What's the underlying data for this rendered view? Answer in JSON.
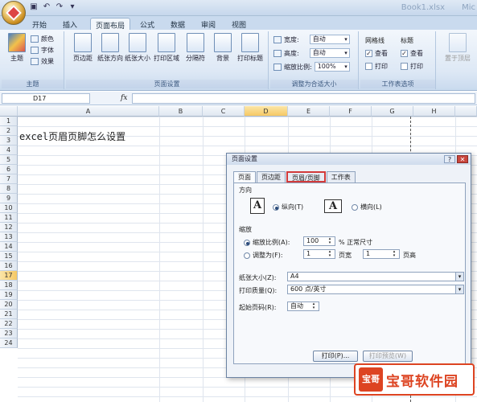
{
  "titlebar": {
    "app_title": "Book1.xlsx",
    "app_title_suffix": "Mic"
  },
  "tabs": [
    "开始",
    "插入",
    "页面布局",
    "公式",
    "数据",
    "审阅",
    "视图"
  ],
  "ribbon": {
    "themes": {
      "big": "主题",
      "colors": "颜色",
      "fonts": "字体",
      "effects": "效果",
      "group": "主题"
    },
    "page_setup": {
      "buttons": [
        "页边距",
        "纸张方向",
        "纸张大小",
        "打印区域",
        "分隔符",
        "背景",
        "打印标题"
      ],
      "group": "页面设置"
    },
    "scale_to_fit": {
      "width_label": "宽度:",
      "width_value": "自动",
      "height_label": "高度:",
      "height_value": "自动",
      "scale_label": "缩放比例:",
      "scale_value": "100%",
      "group": "调整为合适大小"
    },
    "sheet_options": {
      "gridlines": "网格线",
      "headings": "标题",
      "view": "查看",
      "print": "打印",
      "group": "工作表选项"
    },
    "arrange": {
      "label": "置于顶层"
    }
  },
  "formula_bar": {
    "name_box": "D17",
    "fx": "fx"
  },
  "columns": [
    "A",
    "B",
    "C",
    "D",
    "E",
    "F",
    "G",
    "H"
  ],
  "rows": [
    "1",
    "2",
    "3",
    "4",
    "5",
    "6",
    "7",
    "8",
    "9",
    "10",
    "11",
    "12",
    "13",
    "14",
    "15",
    "16",
    "17",
    "18",
    "19",
    "20",
    "21",
    "22",
    "23",
    "24"
  ],
  "cell_a1": "excel页眉页脚怎么设置",
  "dialog": {
    "title": "页面设置",
    "tabs": [
      "页面",
      "页边距",
      "页眉/页脚",
      "工作表"
    ],
    "orientation_label": "方向",
    "portrait": "纵向(T)",
    "landscape": "横向(L)",
    "scaling_label": "缩放",
    "adjust_to": "缩放比例(A):",
    "adjust_value": "100",
    "adjust_unit": "% 正常尺寸",
    "fit_to": "调整为(F):",
    "fit_pages_wide": "1",
    "pages_wide_label": "页宽",
    "fit_pages_tall": "1",
    "pages_tall_label": "页高",
    "paper_size_label": "纸张大小(Z):",
    "paper_size_value": "A4",
    "print_quality_label": "打印质量(Q):",
    "print_quality_value": "600 点/英寸",
    "first_page_label": "起始页码(R):",
    "first_page_value": "自动",
    "print_button": "打印(P)...",
    "preview_button": "打印预览(W)"
  },
  "watermark": {
    "badge": "宝哥",
    "text": "宝哥软件园"
  }
}
